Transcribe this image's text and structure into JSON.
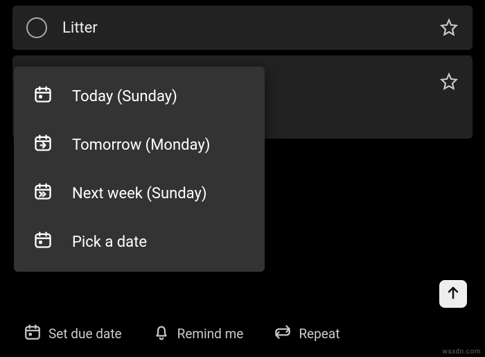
{
  "tasks": [
    {
      "title": "Litter"
    }
  ],
  "due_date_menu": {
    "items": [
      {
        "label": "Today (Sunday)"
      },
      {
        "label": "Tomorrow (Monday)"
      },
      {
        "label": "Next week (Sunday)"
      },
      {
        "label": "Pick a date"
      }
    ]
  },
  "add_task_actions": {
    "due_date": "Set due date",
    "remind": "Remind me",
    "repeat": "Repeat"
  },
  "watermark": "wsxdn.com"
}
